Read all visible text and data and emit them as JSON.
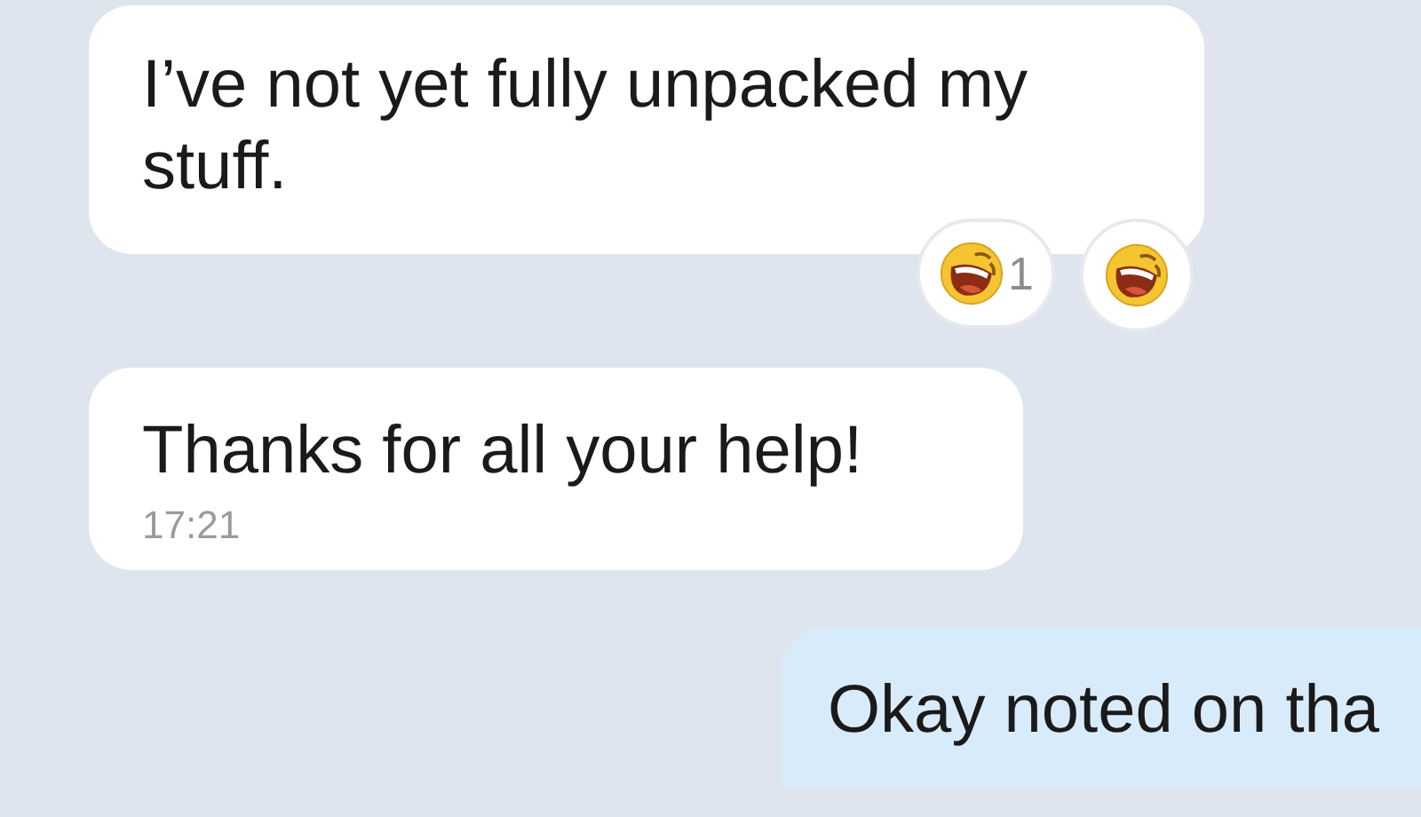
{
  "messages": [
    {
      "kind": "incoming",
      "text": "I’ve not yet fully unpacked my stuff.",
      "reactions": [
        {
          "kind": "counted",
          "count": "1"
        },
        {
          "kind": "plain"
        }
      ]
    },
    {
      "kind": "incoming",
      "text": "Thanks for all your help!",
      "time": "17:21"
    },
    {
      "kind": "outgoing",
      "text": "Okay noted on tha"
    }
  ]
}
